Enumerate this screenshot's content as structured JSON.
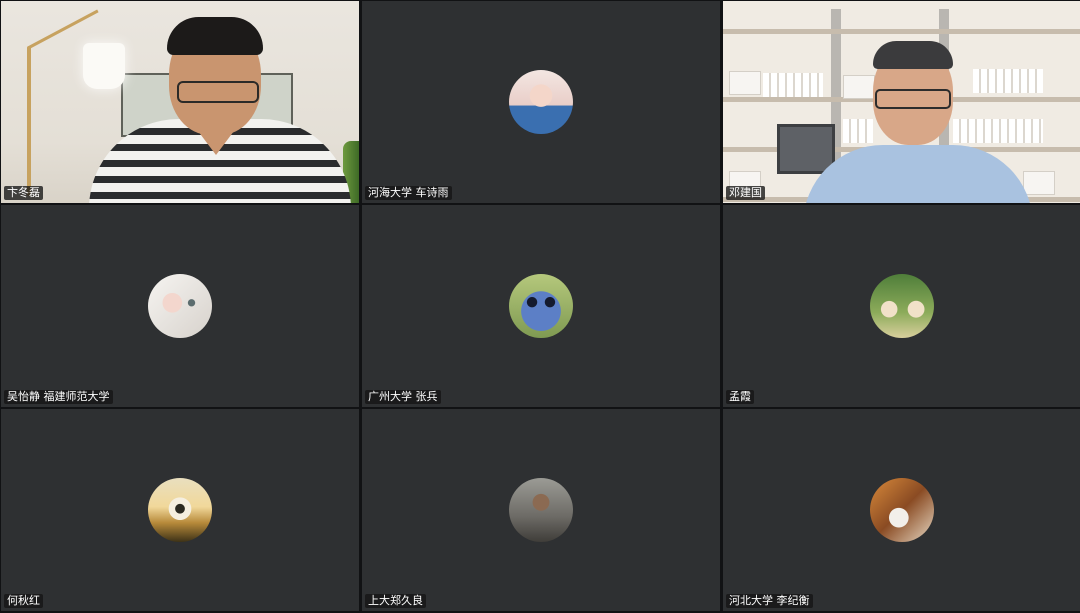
{
  "meeting": {
    "participants": [
      {
        "name": "卞冬磊",
        "mode": "video",
        "active": true
      },
      {
        "name": "河海大学 车诗雨",
        "mode": "avatar",
        "avatar": "girl-with-pink-headphones"
      },
      {
        "name": "邓建国",
        "mode": "video"
      },
      {
        "name": "吴怡静 福建师范大学",
        "mode": "avatar",
        "avatar": "white-cat"
      },
      {
        "name": "广州大学 张兵",
        "mode": "avatar",
        "avatar": "stitch-cartoon"
      },
      {
        "name": "孟霞",
        "mode": "avatar",
        "avatar": "giraffe-cartoon"
      },
      {
        "name": "何秋红",
        "mode": "avatar",
        "avatar": "flower-sunset"
      },
      {
        "name": "上大郑久良",
        "mode": "avatar",
        "avatar": "man-portrait"
      },
      {
        "name": "河北大学 李纪衡",
        "mode": "avatar",
        "avatar": "autumn-scene"
      }
    ]
  },
  "colors": {
    "tile_bg": "#2e3032",
    "active_border": "#2ea44f",
    "label_bg": "#141414",
    "label_text": "#ffffff"
  }
}
